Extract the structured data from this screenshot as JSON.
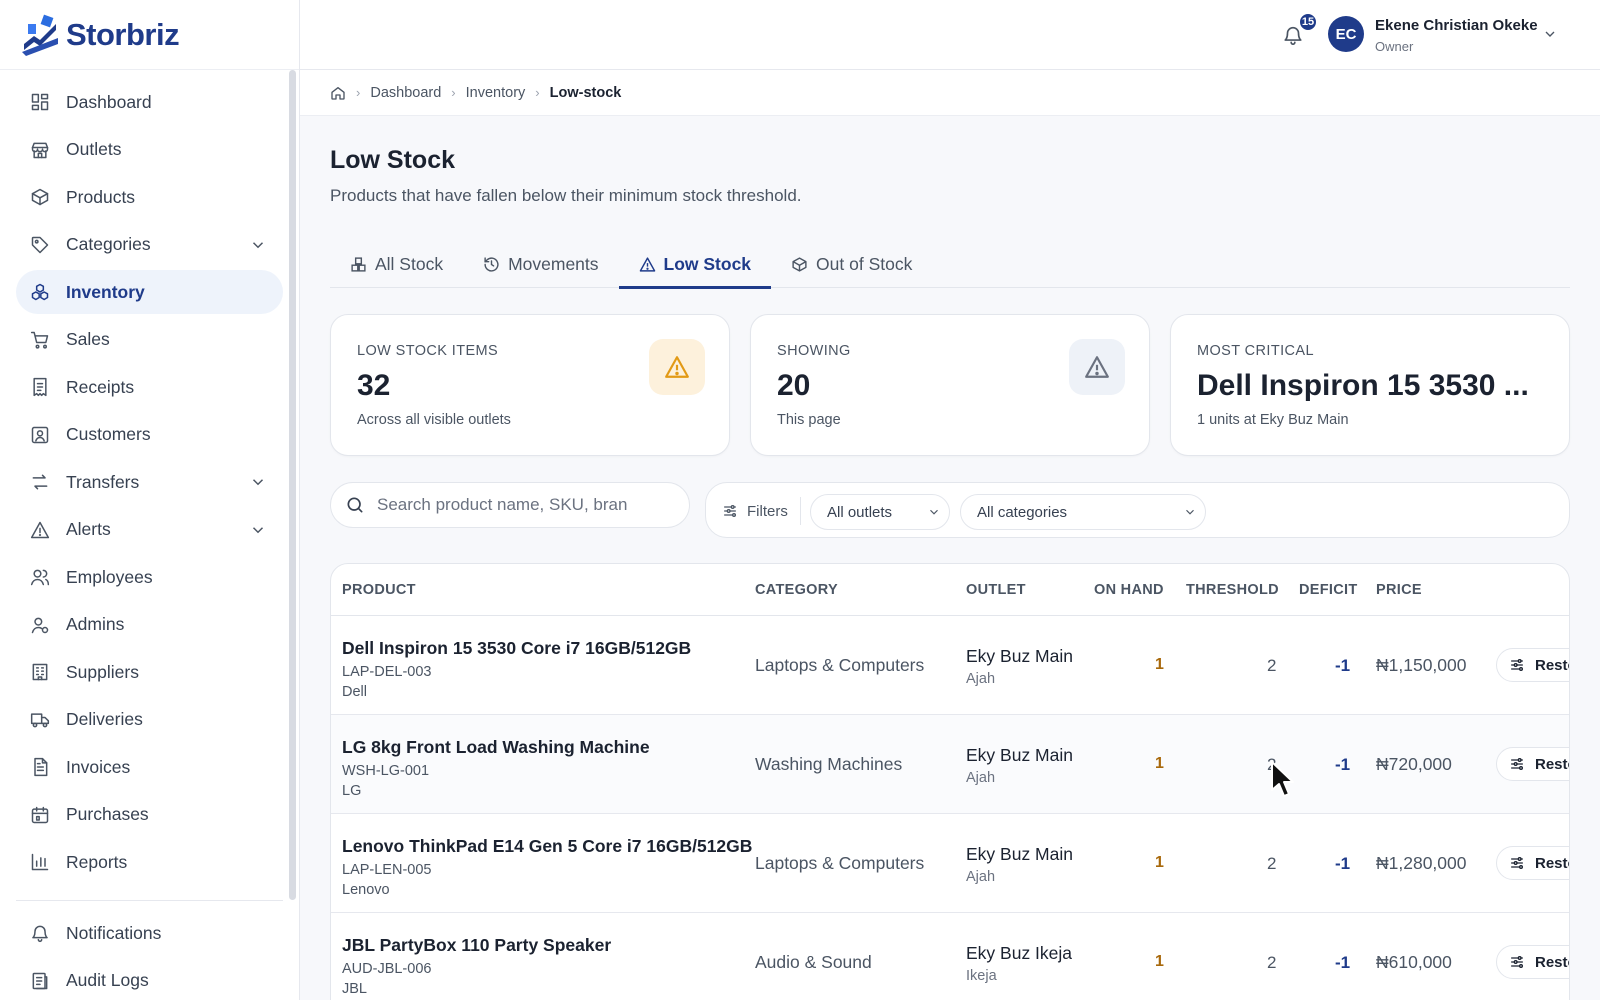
{
  "brand": {
    "name": "Storbriz",
    "color": "#1f3b8a"
  },
  "sidebar": {
    "items": [
      {
        "label": "Dashboard",
        "icon": "dashboard-icon"
      },
      {
        "label": "Outlets",
        "icon": "store-icon"
      },
      {
        "label": "Products",
        "icon": "box-icon"
      },
      {
        "label": "Categories",
        "icon": "tag-icon",
        "expandable": true
      },
      {
        "label": "Inventory",
        "icon": "inventory-icon",
        "active": true
      },
      {
        "label": "Sales",
        "icon": "cart-icon"
      },
      {
        "label": "Receipts",
        "icon": "receipt-icon"
      },
      {
        "label": "Customers",
        "icon": "customer-icon"
      },
      {
        "label": "Transfers",
        "icon": "transfer-icon",
        "expandable": true
      },
      {
        "label": "Alerts",
        "icon": "alert-icon",
        "expandable": true
      },
      {
        "label": "Employees",
        "icon": "users-icon"
      },
      {
        "label": "Admins",
        "icon": "admin-icon"
      },
      {
        "label": "Suppliers",
        "icon": "building-icon"
      },
      {
        "label": "Deliveries",
        "icon": "truck-icon"
      },
      {
        "label": "Invoices",
        "icon": "invoice-icon"
      },
      {
        "label": "Purchases",
        "icon": "purchase-icon"
      },
      {
        "label": "Reports",
        "icon": "chart-icon"
      }
    ],
    "bottom_items": [
      {
        "label": "Notifications",
        "icon": "bell-icon"
      },
      {
        "label": "Audit Logs",
        "icon": "audit-icon"
      }
    ]
  },
  "header": {
    "notification_count": "15",
    "user": {
      "initials": "EC",
      "name": "Ekene Christian Okeke",
      "role": "Owner"
    }
  },
  "breadcrumb": {
    "items": [
      "Dashboard",
      "Inventory"
    ],
    "current": "Low-stock"
  },
  "page": {
    "title": "Low Stock",
    "subtitle": "Products that have fallen below their minimum stock threshold."
  },
  "tabs": [
    {
      "label": "All Stock",
      "icon": "boxes-icon"
    },
    {
      "label": "Movements",
      "icon": "history-icon"
    },
    {
      "label": "Low Stock",
      "icon": "warning-icon",
      "active": true
    },
    {
      "label": "Out of Stock",
      "icon": "package-x-icon"
    }
  ],
  "stats": [
    {
      "label": "LOW STOCK ITEMS",
      "value": "32",
      "sub": "Across all visible outlets",
      "accent": "#f4a51c"
    },
    {
      "label": "SHOWING",
      "value": "20",
      "sub": "This page",
      "accent": "#6b7280"
    },
    {
      "label": "MOST CRITICAL",
      "value": "Dell Inspiron 15 3530 ...",
      "sub": "1 units at Eky Buz Main"
    }
  ],
  "search": {
    "placeholder": "Search product name, SKU, bran",
    "value": ""
  },
  "filters": {
    "label": "Filters",
    "outlet": "All outlets",
    "category": "All categories"
  },
  "table": {
    "columns": [
      "PRODUCT",
      "CATEGORY",
      "OUTLET",
      "ON HAND",
      "THRESHOLD",
      "DEFICIT",
      "PRICE"
    ],
    "action_label": "Resto",
    "rows": [
      {
        "name": "Dell Inspiron 15 3530 Core i7 16GB/512GB",
        "sku": "LAP-DEL-003",
        "brand": "Dell",
        "category": "Laptops & Computers",
        "outlet": "Eky Buz Main",
        "area": "Ajah",
        "on_hand": "1",
        "threshold": "2",
        "deficit": "-1",
        "price": "₦1,150,000"
      },
      {
        "name": "LG 8kg Front Load Washing Machine",
        "sku": "WSH-LG-001",
        "brand": "LG",
        "category": "Washing Machines",
        "outlet": "Eky Buz Main",
        "area": "Ajah",
        "on_hand": "1",
        "threshold": "2",
        "deficit": "-1",
        "price": "₦720,000"
      },
      {
        "name": "Lenovo ThinkPad E14 Gen 5 Core i7 16GB/512GB",
        "sku": "LAP-LEN-005",
        "brand": "Lenovo",
        "category": "Laptops & Computers",
        "outlet": "Eky Buz Main",
        "area": "Ajah",
        "on_hand": "1",
        "threshold": "2",
        "deficit": "-1",
        "price": "₦1,280,000"
      },
      {
        "name": "JBL PartyBox 110 Party Speaker",
        "sku": "AUD-JBL-006",
        "brand": "JBL",
        "category": "Audio & Sound",
        "outlet": "Eky Buz Ikeja",
        "area": "Ikeja",
        "on_hand": "1",
        "threshold": "2",
        "deficit": "-1",
        "price": "₦610,000"
      }
    ]
  }
}
